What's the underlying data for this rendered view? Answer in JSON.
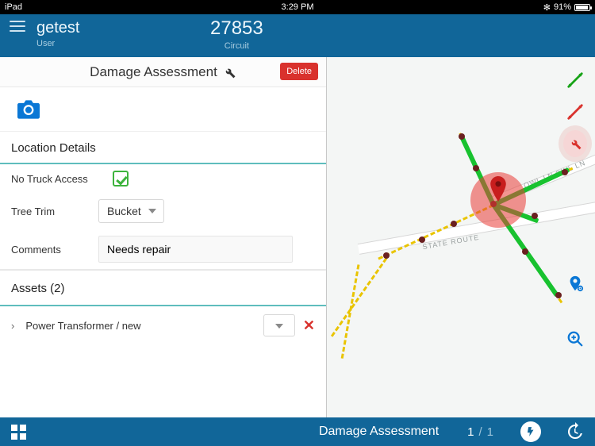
{
  "statusbar": {
    "device": "iPad",
    "time": "3:29 PM",
    "battery_text": "91%"
  },
  "header": {
    "user_name": "getest",
    "user_label": "User",
    "circuit_id": "27853",
    "circuit_label": "Circuit"
  },
  "form": {
    "title": "Damage Assessment",
    "delete_label": "Delete",
    "sections": {
      "location_details_title": "Location Details",
      "no_truck_access_label": "No Truck Access",
      "no_truck_access_checked": true,
      "tree_trim_label": "Tree Trim",
      "tree_trim_value": "Bucket",
      "comments_label": "Comments",
      "comments_value": "Needs repair"
    },
    "assets": {
      "title": "Assets (2)",
      "items": [
        {
          "label": "Power Transformer / new"
        }
      ]
    }
  },
  "map": {
    "road_labels": {
      "state_route": "STATE ROUTE",
      "owl_ln_1": "OWL LN",
      "owl_ln_2": "OWL LN"
    }
  },
  "bottombar": {
    "title": "Damage Assessment",
    "page_current": "1",
    "page_sep": "/",
    "page_total": "1"
  },
  "colors": {
    "brand": "#116699",
    "danger": "#d9322d",
    "accent_blue": "#0a77d5",
    "ok_green": "#3db33d"
  }
}
